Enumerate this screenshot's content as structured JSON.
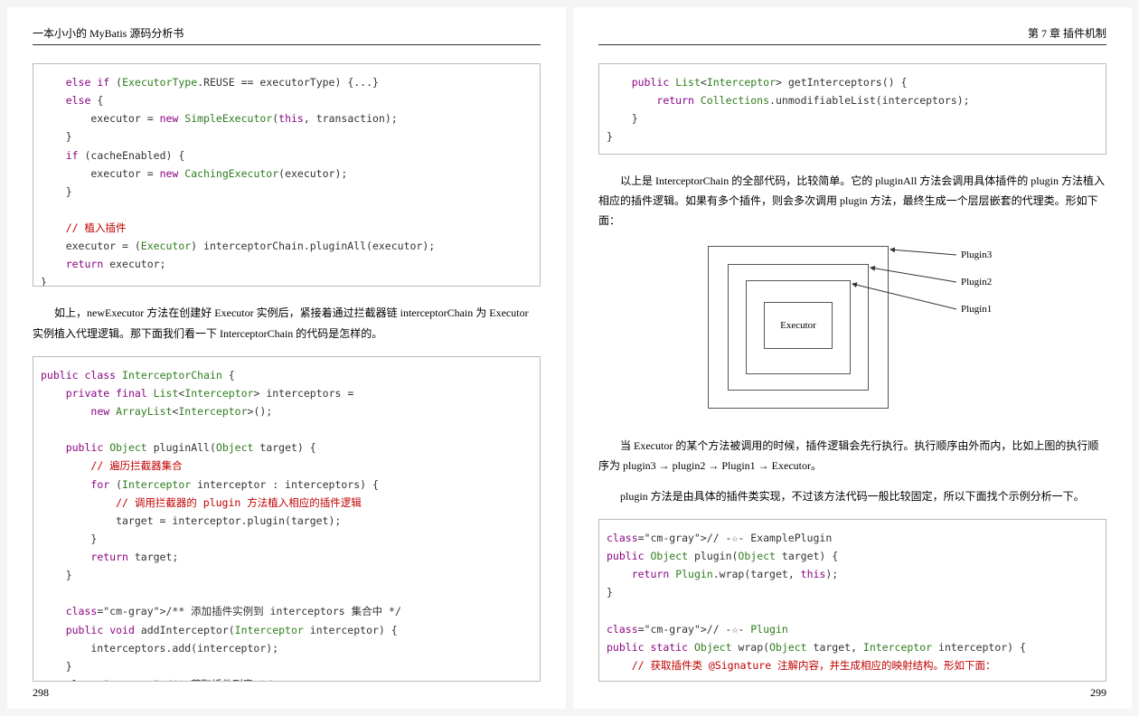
{
  "left": {
    "header": "一本小小的 MyBatis 源码分析书",
    "pageNum": "298",
    "code1": "    else if (ExecutorType.REUSE == executorType) {...}\n    else {\n        executor = new SimpleExecutor(this, transaction);\n    }\n    if (cacheEnabled) {\n        executor = new CachingExecutor(executor);\n    }\n\n    // 植入插件\n    executor = (Executor) interceptorChain.pluginAll(executor);\n    return executor;\n}",
    "para1": "如上，newExecutor 方法在创建好 Executor 实例后，紧接着通过拦截器链 interceptorChain 为 Executor 实例植入代理逻辑。那下面我们看一下 InterceptorChain 的代码是怎样的。",
    "code2": "public class InterceptorChain {\n    private final List<Interceptor> interceptors =\n        new ArrayList<Interceptor>();\n\n    public Object pluginAll(Object target) {\n        // 遍历拦截器集合\n        for (Interceptor interceptor : interceptors) {\n            // 调用拦截器的 plugin 方法植入相应的插件逻辑\n            target = interceptor.plugin(target);\n        }\n        return target;\n    }\n\n    /** 添加插件实例到 interceptors 集合中 */\n    public void addInterceptor(Interceptor interceptor) {\n        interceptors.add(interceptor);\n    }\n    /** 获取插件列表 */"
  },
  "right": {
    "header": "第 7 章  插件机制",
    "pageNum": "299",
    "code1": "    public List<Interceptor> getInterceptors() {\n        return Collections.unmodifiableList(interceptors);\n    }\n}",
    "para1": "以上是 InterceptorChain 的全部代码，比较简单。它的 pluginAll 方法会调用具体插件的 plugin 方法植入相应的插件逻辑。如果有多个插件，则会多次调用 plugin 方法，最终生成一个层层嵌套的代理类。形如下面：",
    "diagram": {
      "center": "Executor",
      "labels": [
        "Plugin3",
        "Plugin2",
        "Plugin1"
      ]
    },
    "para2": "当 Executor 的某个方法被调用的时候，插件逻辑会先行执行。执行顺序由外而内，比如上图的执行顺序为 plugin3 → plugin2 → Plugin1 → Executor。",
    "para3": "plugin 方法是由具体的插件类实现，不过该方法代码一般比较固定，所以下面找个示例分析一下。",
    "code2": "// -☆- ExamplePlugin\npublic Object plugin(Object target) {\n    return Plugin.wrap(target, this);\n}\n\n// -☆- Plugin\npublic static Object wrap(Object target, Interceptor interceptor) {\n    // 获取插件类 @Signature 注解内容，并生成相应的映射结构。形如下面："
  }
}
